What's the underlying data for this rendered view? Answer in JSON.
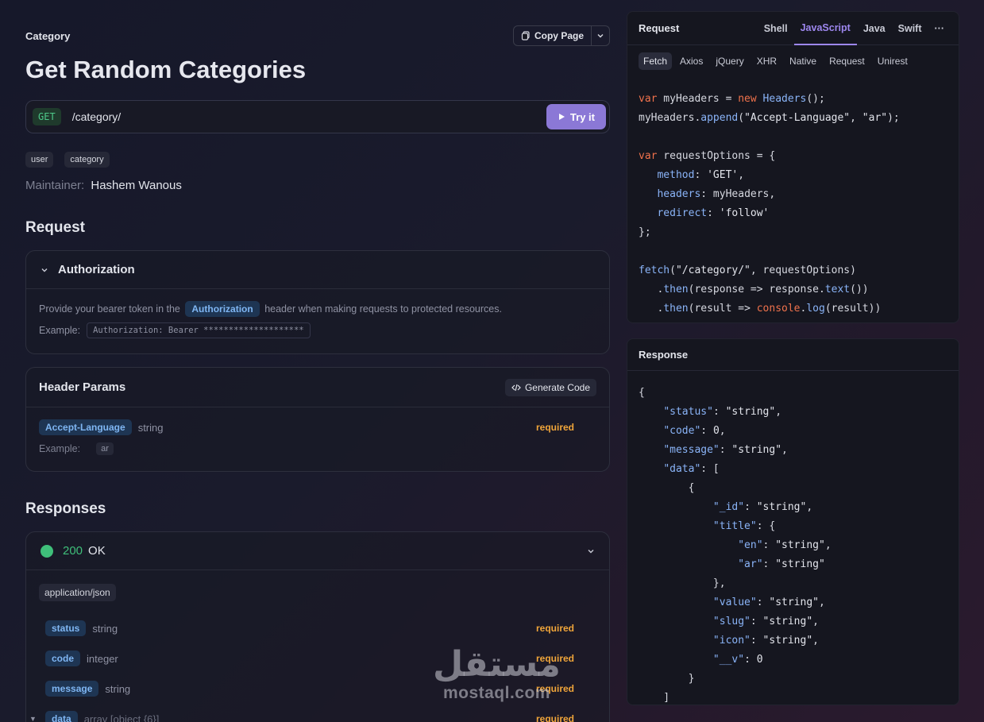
{
  "header": {
    "category_label": "Category",
    "copy_page": "Copy Page",
    "title": "Get Random Categories"
  },
  "endpoint": {
    "method": "GET",
    "path": "/category/",
    "try_it": "Try it"
  },
  "tags": [
    "user",
    "category"
  ],
  "maintainer": {
    "label": "Maintainer:",
    "name": "Hashem Wanous"
  },
  "request_section": {
    "title": "Request",
    "authorization": {
      "title": "Authorization",
      "desc_before": "Provide your bearer token in the",
      "desc_chip": "Authorization",
      "desc_after": "header when making requests to protected resources.",
      "example_label": "Example:",
      "example_value": "Authorization: Bearer ********************"
    },
    "header_params": {
      "title": "Header Params",
      "generate_code": "Generate Code",
      "param": {
        "name": "Accept-Language",
        "type": "string",
        "required": "required",
        "example_label": "Example:",
        "example_value": "ar"
      }
    }
  },
  "responses": {
    "title": "Responses",
    "status_code": "200",
    "status_text": "OK",
    "content_type": "application/json",
    "fields": [
      {
        "name": "status",
        "type": "string",
        "required": "required"
      },
      {
        "name": "code",
        "type": "integer",
        "required": "required"
      },
      {
        "name": "message",
        "type": "string",
        "required": "required"
      },
      {
        "name": "data",
        "type": "array [object {6}]",
        "required": "required"
      }
    ]
  },
  "request_panel": {
    "title": "Request",
    "lang_tabs": [
      "Shell",
      "JavaScript",
      "Java",
      "Swift"
    ],
    "active_lang": "JavaScript",
    "libs": [
      "Fetch",
      "Axios",
      "jQuery",
      "XHR",
      "Native",
      "Request",
      "Unirest"
    ],
    "active_lib": "Fetch"
  },
  "response_panel": {
    "title": "Response"
  },
  "watermark": {
    "arabic": "مستقل",
    "latin": "mostaql.com"
  },
  "colors": {
    "accent": "#8b78d6",
    "success": "#3fbf7a",
    "required": "#f0a53a",
    "param_chip": "#7fb6f3"
  }
}
